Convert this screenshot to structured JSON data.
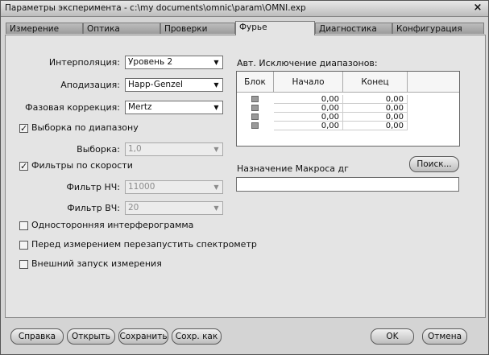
{
  "window": {
    "title": "Параметры эксперимента - c:\\my documents\\omnic\\param\\OMNI.exp",
    "close_glyph": "×"
  },
  "tabs": [
    "Измерение",
    "Оптика",
    "Проверки",
    "Фурье",
    "Диагностика",
    "Конфигурация"
  ],
  "active_tab": "Фурье",
  "fields": {
    "interpolation": {
      "label": "Интерполяция:",
      "value": "Уровень 2"
    },
    "apodization": {
      "label": "Аподизация:",
      "value": "Happ-Genzel"
    },
    "phase": {
      "label": "Фазовая коррекция:",
      "value": "Mertz"
    },
    "sampling": {
      "label": "Выборка:",
      "value": "1,0"
    },
    "lowpass": {
      "label": "Фильтр НЧ:",
      "value": "11000"
    },
    "highpass": {
      "label": "Фильтр ВЧ:",
      "value": "20"
    }
  },
  "checkboxes": {
    "range_sampling": {
      "label": "Выборка по диапазону",
      "checked": true
    },
    "speed_filters": {
      "label": "Фильтры по скорости",
      "checked": true
    },
    "one_sided": {
      "label": "Односторонняя интерферограмма",
      "checked": false
    },
    "restart": {
      "label": "Перед измерением перезапустить спектрометр",
      "checked": false
    },
    "external": {
      "label": "Внешний запуск измерения",
      "checked": false
    }
  },
  "check_glyph": "✓",
  "arrow_glyph": "▼",
  "exclusion": {
    "label": "Авт. Исключение диапазонов:",
    "headers": [
      "Блок",
      "Начало",
      "Конец"
    ],
    "rows": [
      [
        "0,00",
        "0,00"
      ],
      [
        "0,00",
        "0,00"
      ],
      [
        "0,00",
        "0,00"
      ],
      [
        "0,00",
        "0,00"
      ]
    ]
  },
  "macro": {
    "label": "Назначение Макроса дг",
    "search_button": "Поиск..."
  },
  "buttons": {
    "help": "Справка",
    "open": "Открыть",
    "save": "Сохранить",
    "save_as": "Сохр. как",
    "ok": "OK",
    "cancel": "Отмена"
  }
}
